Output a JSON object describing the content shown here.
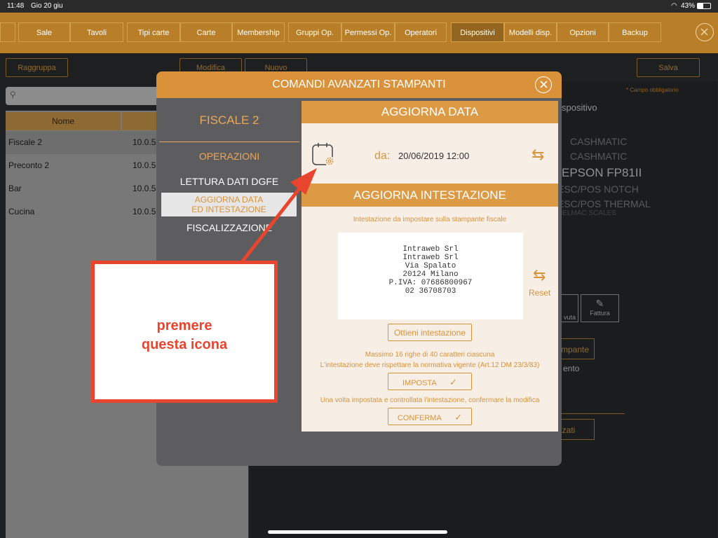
{
  "status": {
    "time": "11:48",
    "date": "Gio 20 giu",
    "battery": "43%"
  },
  "nav": [
    "Sale",
    "Tavoli",
    "Tipi carte",
    "Carte",
    "Membership",
    "Gruppi Op.",
    "Permessi Op.",
    "Operatori",
    "Dispositivi",
    "Modelli disp.",
    "Opzioni",
    "Backup"
  ],
  "toolbar": {
    "raggruppa": "Raggruppa",
    "modifica": "Modifica",
    "nuovo": "Nuovo",
    "salva": "Salva"
  },
  "table": {
    "header_nome": "Nome",
    "rows": [
      {
        "nome": "Fiscale 2",
        "ip": "10.0.5"
      },
      {
        "nome": "Preconto 2",
        "ip": "10.0.5"
      },
      {
        "nome": "Bar",
        "ip": "10.0.5"
      },
      {
        "nome": "Cucina",
        "ip": "10.0.5"
      }
    ]
  },
  "right": {
    "required": "* Campo obbligatorio",
    "dispositivo": "spositivo",
    "models": [
      "CASHMATIC",
      "CASHMATIC",
      "EPSON FP81II",
      "ESC/POS NOTCH",
      "ESC/POS THERMAL",
      "HELMAC SCALES"
    ],
    "icon_ricevuta": "vuta",
    "icon_fattura": "Fattura",
    "stampante": "mpante",
    "ento": "ento",
    "nzati": "nzati"
  },
  "modal": {
    "title": "COMANDI AVANZATI STAMPANTI",
    "device": "FISCALE 2",
    "operazioni": "OPERAZIONI",
    "op1": "LETTURA DATI DGFE",
    "op2a": "AGGIORNA DATA",
    "op2b": "ED INTESTAZIONE",
    "op3": "FISCALIZZAZIONE",
    "aggiorna_data": "AGGIORNA DATA",
    "da_label": "da:",
    "date_value": "20/06/2019 12:00",
    "aggiorna_intestazione": "AGGIORNA INTESTAZIONE",
    "intest_hint": "Intestazione da impostare sulla stampante fiscale",
    "receipt": [
      "Intraweb Srl",
      "Intraweb Srl",
      "Via Spalato",
      "20124 Milano",
      "P.IVA: 07686800967",
      "02 36708703"
    ],
    "reset": "Reset",
    "ottieni": "Ottieni intestazione",
    "max_lines": "Massimo 16 righe di 40 caratteri ciascuna",
    "normativa": "L'intestazione deve rispettare la normativa vigente (Art.12 DM 23/3/83)",
    "imposta": "IMPOSTA",
    "conferma_hint": "Una volta impostata e controllata l'intestazione, confermare la modifica",
    "conferma": "CONFERMA",
    "check": "✓"
  },
  "annotation": {
    "line1": "premere",
    "line2": "questa icona"
  },
  "colors": {
    "accent": "#d9923a",
    "annotation": "#e8452f"
  }
}
